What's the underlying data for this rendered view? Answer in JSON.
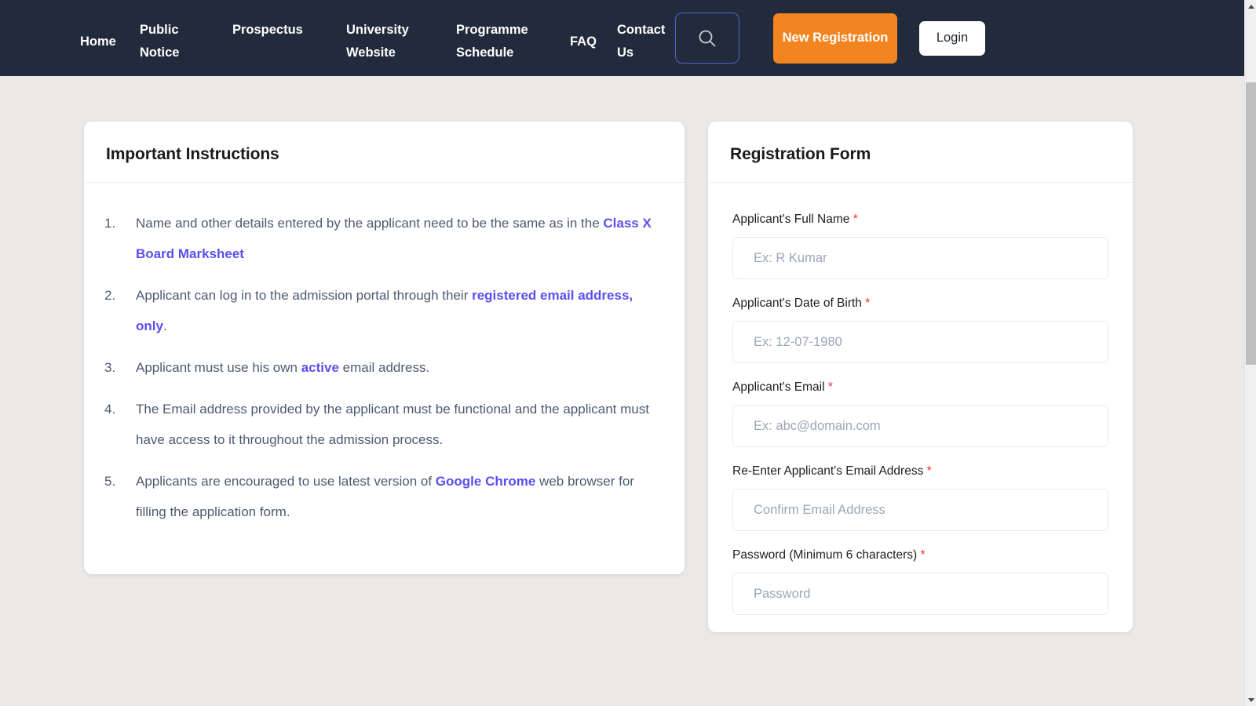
{
  "navbar": {
    "items": [
      {
        "label": "Home"
      },
      {
        "label": "Public Notice"
      },
      {
        "label": "Prospectus"
      },
      {
        "label": "University Website"
      },
      {
        "label": "Programme Schedule"
      },
      {
        "label": "FAQ"
      },
      {
        "label": "Contact Us"
      }
    ],
    "search_icon": "search-icon",
    "register_label": "New Registration",
    "login_label": "Login",
    "colors": {
      "bar_bg": "#222b3c",
      "register_bg": "#f2851f",
      "search_border": "#5b5bd6",
      "login_bg": "#ffffff"
    }
  },
  "instructions": {
    "title": "Important Instructions",
    "items": [
      {
        "num": "1.",
        "html": "Name and other details entered by the applicant need to be the same as in the <b>Class X Board Marksheet</b>"
      },
      {
        "num": "2.",
        "html": "Applicant can log in to the admission portal through their <b>registered email address, only</b>."
      },
      {
        "num": "3.",
        "html": "Applicant must use his own <b>active</b> email address."
      },
      {
        "num": "4.",
        "html": "The Email address provided by the applicant must be functional and the applicant must have access to it throughout the admission process."
      },
      {
        "num": "5.",
        "html": "Applicants are encouraged to use latest version of <b>Google Chrome</b> web browser for filling the application form."
      }
    ],
    "highlight_color": "#5a4ff3",
    "text_color": "#4c5a72"
  },
  "registration": {
    "title": "Registration Form",
    "required_marker": "*",
    "fields": [
      {
        "label": "Applicant's Full Name",
        "required": true,
        "placeholder": "Ex: R Kumar",
        "value": ""
      },
      {
        "label": "Applicant's Date of Birth",
        "required": true,
        "placeholder": "Ex: 12-07-1980",
        "value": ""
      },
      {
        "label": "Applicant's Email",
        "required": true,
        "placeholder": "Ex: abc@domain.com",
        "value": ""
      },
      {
        "label": "Re-Enter Applicant's Email Address",
        "required": true,
        "placeholder": "Confirm Email Address",
        "value": ""
      },
      {
        "label": "Password (Minimum 6 characters)",
        "required": true,
        "placeholder": "Password",
        "value": ""
      }
    ]
  },
  "scrollbar": {
    "up_arrow_icon": "chevron-up-icon",
    "down_arrow_icon": "chevron-down-icon"
  },
  "page": {
    "background": "#eae9e7"
  }
}
